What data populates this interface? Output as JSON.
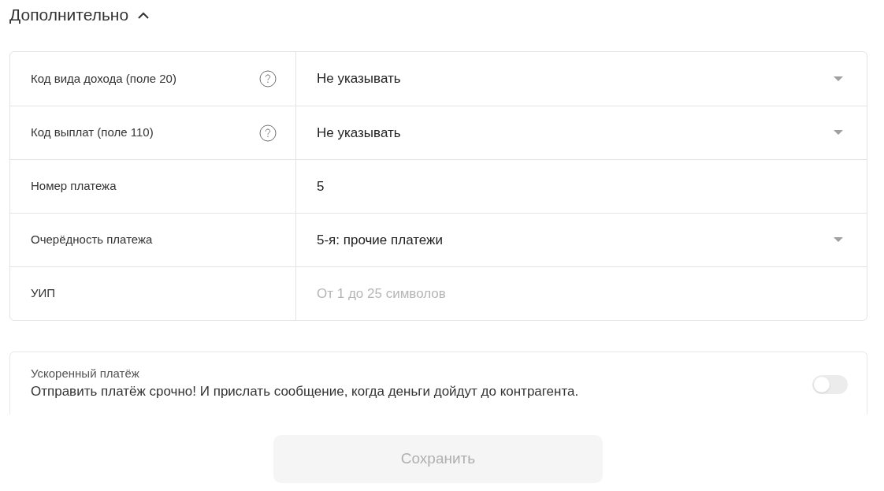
{
  "section": {
    "title": "Дополнительно",
    "expanded": true
  },
  "fields": [
    {
      "label": "Код вида дохода (поле 20)",
      "help": true,
      "kind": "select",
      "value": "Не указывать"
    },
    {
      "label": "Код выплат (поле 110)",
      "help": true,
      "kind": "select",
      "value": "Не указывать"
    },
    {
      "label": "Номер платежа",
      "help": false,
      "kind": "input",
      "value": "5"
    },
    {
      "label": "Очерёдность платежа",
      "help": false,
      "kind": "select",
      "value": "5-я: прочие платежи"
    },
    {
      "label": "УИП",
      "help": false,
      "kind": "input",
      "placeholder": "От 1 до 25 символов"
    }
  ],
  "urgent": {
    "title": "Ускоренный платёж",
    "description": "Отправить платёж срочно! И прислать сообщение, когда деньги дойдут до контрагента.",
    "on": false
  },
  "save_button": {
    "label": "Сохранить",
    "disabled": true
  }
}
